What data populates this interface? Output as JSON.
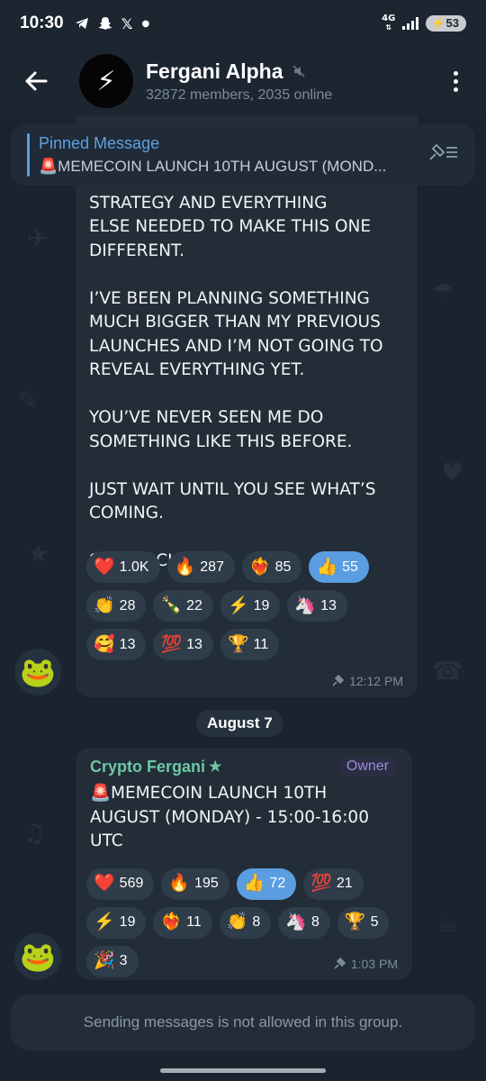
{
  "status_bar": {
    "time": "10:30",
    "network": "4G",
    "battery": "53",
    "app_icons": [
      "telegram-icon",
      "snapchat-icon",
      "x-icon",
      "dot-icon"
    ]
  },
  "header": {
    "title": "Fergani Alpha",
    "subtitle": "32872 members, 2035 online",
    "avatar_emoji": "⚡"
  },
  "pinned": {
    "title": "Pinned Message",
    "preview": "🚨MEMECOIN LAUNCH 10TH AUGUST (MOND..."
  },
  "message1": {
    "text": "WEBSITE, THE MINI-GAME, THE\nSTRATEGY AND EVERYTHING\nELSE NEEDED TO MAKE THIS ONE\nDIFFERENT.\n\nI’VE BEEN PLANNING SOMETHING\nMUCH BIGGER THAN MY PREVIOUS\nLAUNCHES AND I’M NOT GOING TO\nREVEAL EVERYTHING YET.\n\nYOU’VE NEVER SEEN ME DO\nSOMETHING LIKE THIS BEFORE.\n\nJUST WAIT UNTIL YOU SEE WHAT’S\nCOMING.\n\nSTAY LOCKED IN.",
    "reactions": [
      {
        "emoji": "❤️",
        "count": "1.0K"
      },
      {
        "emoji": "🔥",
        "count": "287"
      },
      {
        "emoji": "❤️‍🔥",
        "count": "85"
      },
      {
        "emoji": "👍",
        "count": "55",
        "active": true
      },
      {
        "emoji": "👏",
        "count": "28"
      },
      {
        "emoji": "🍾",
        "count": "22"
      },
      {
        "emoji": "⚡",
        "count": "19"
      },
      {
        "emoji": "🦄",
        "count": "13"
      },
      {
        "emoji": "🥰",
        "count": "13"
      },
      {
        "emoji": "💯",
        "count": "13"
      },
      {
        "emoji": "🏆",
        "count": "11"
      }
    ],
    "time": "12:12 PM"
  },
  "date_separator": "August 7",
  "message2": {
    "sender": "Crypto Fergani",
    "badge": "Owner",
    "text": "🚨MEMECOIN LAUNCH 10TH\nAUGUST (MONDAY) - 15:00-16:00\nUTC",
    "reactions": [
      {
        "emoji": "❤️",
        "count": "569"
      },
      {
        "emoji": "🔥",
        "count": "195"
      },
      {
        "emoji": "👍",
        "count": "72",
        "active": true
      },
      {
        "emoji": "💯",
        "count": "21"
      },
      {
        "emoji": "⚡",
        "count": "19"
      },
      {
        "emoji": "❤️‍🔥",
        "count": "11"
      },
      {
        "emoji": "👏",
        "count": "8"
      },
      {
        "emoji": "🦄",
        "count": "8"
      },
      {
        "emoji": "🏆",
        "count": "5"
      },
      {
        "emoji": "🎉",
        "count": "3"
      }
    ],
    "time": "1:03 PM"
  },
  "user_avatar_emoji": "🐸",
  "footer": {
    "notice": "Sending messages is not allowed in this group."
  },
  "colors": {
    "accent": "#5ea0e0",
    "sender": "#6dc7a5",
    "owner_badge": "#9c8ad8",
    "bubble": "#222d38",
    "background": "#1a232e"
  }
}
